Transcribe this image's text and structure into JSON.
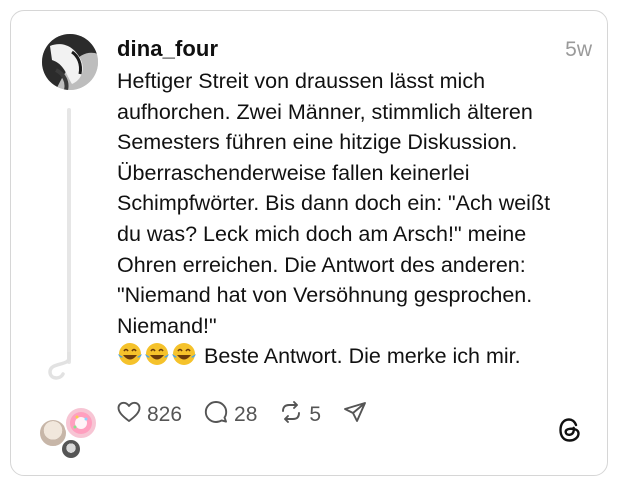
{
  "post": {
    "username": "dina_four",
    "timestamp": "5w",
    "lines": [
      "Heftiger Streit von draussen lässt mich",
      "aufhorchen. Zwei Männer, stimmlich älteren",
      "Semesters führen eine hitzige Diskussion.",
      "Überraschenderweise fallen keinerlei",
      "Schimpfwörter. Bis dann doch ein: \"Ach weißt",
      "du was? Leck mich doch am Arsch!\" meine",
      "Ohren erreichen. Die Antwort des anderen:",
      "\"Niemand hat von Versöhnung gesprochen.",
      "Niemand!\""
    ],
    "last_line_text": "Beste Antwort. Die merke ich mir.",
    "emoji_icons": [
      "tears-of-joy-emoji",
      "tears-of-joy-emoji",
      "tears-of-joy-emoji"
    ]
  },
  "actions": {
    "likes": "826",
    "comments": "28",
    "reposts": "5"
  },
  "icons": {
    "like": "heart-icon",
    "comment": "comment-bubble-icon",
    "repost": "repost-icon",
    "share": "send-icon",
    "brand": "threads-logo-icon"
  },
  "colors": {
    "text": "#101010",
    "muted": "#9a9a9a",
    "action_gray": "#555555",
    "border": "#d6d6d6"
  }
}
